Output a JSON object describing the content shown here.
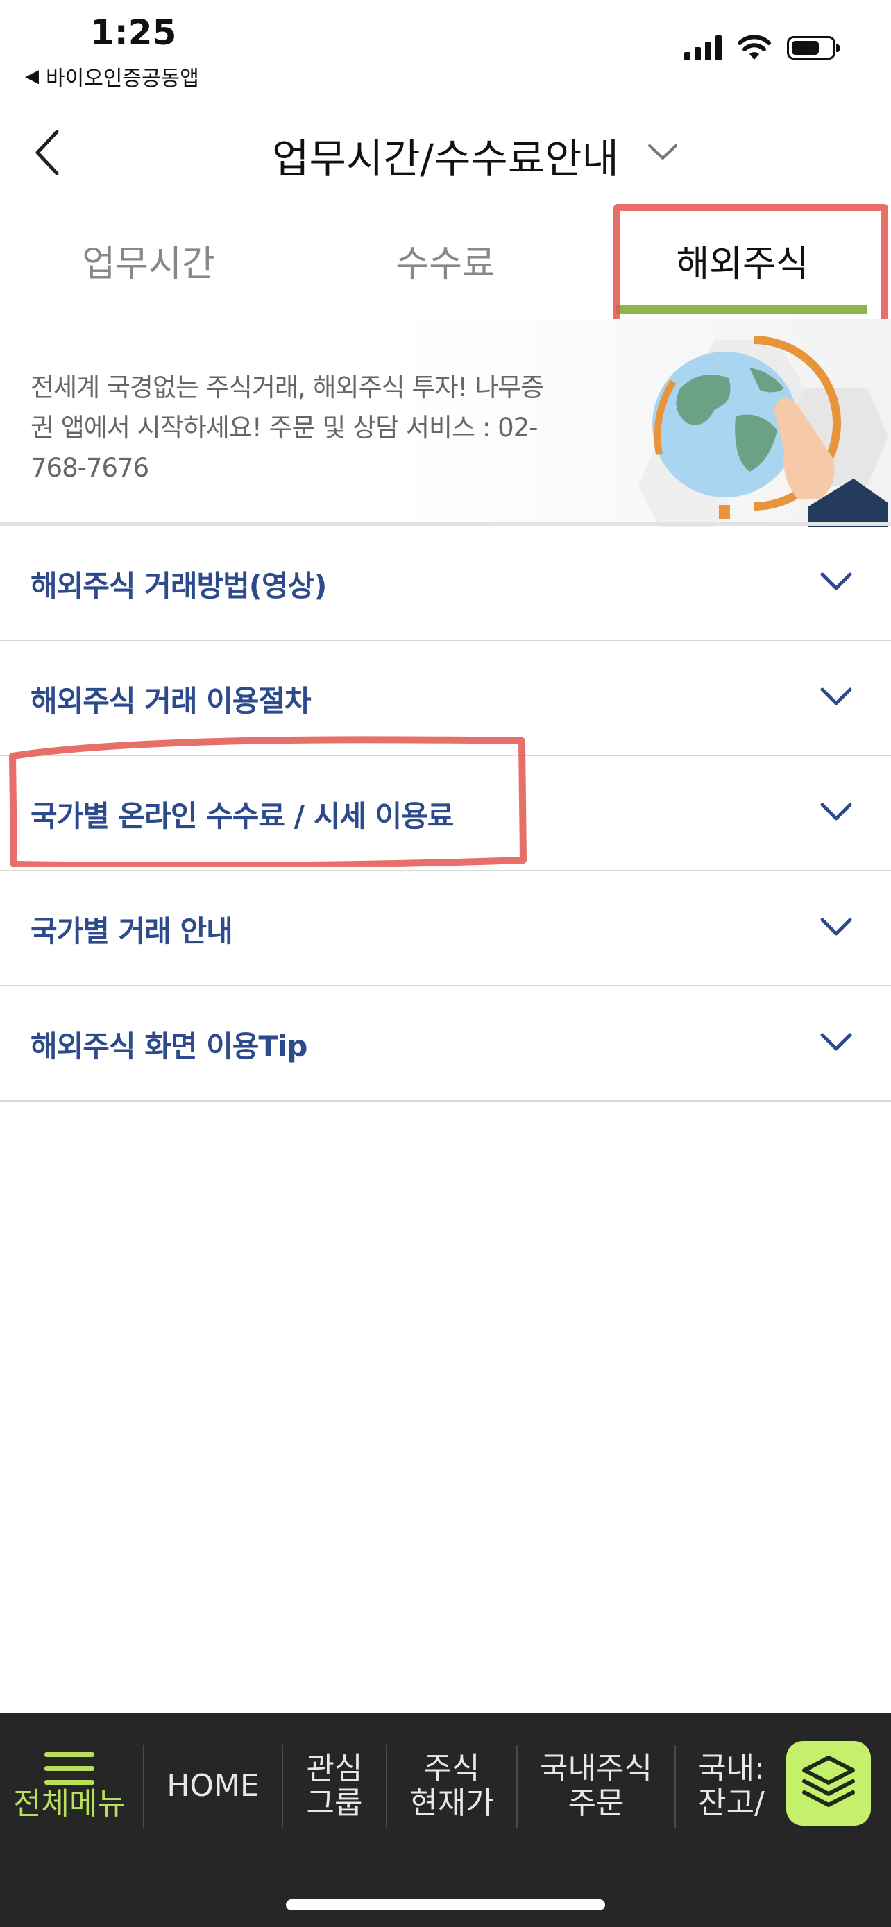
{
  "status_bar": {
    "time": "1:25",
    "back_app_label": "바이오인증공동앱",
    "back_app_icon": "back-triangle-icon",
    "icons": [
      "signal-icon",
      "wifi-icon",
      "battery-icon"
    ],
    "battery_level": 0.7
  },
  "header": {
    "title": "업무시간/수수료안내",
    "back_icon": "chevron-left-icon",
    "dropdown_icon": "chevron-down-icon"
  },
  "tabs": [
    {
      "label": "업무시간",
      "active": false
    },
    {
      "label": "수수료",
      "active": false
    },
    {
      "label": "해외주식",
      "active": true
    }
  ],
  "banner": {
    "text_lines": [
      "전세계 국경없는 주식거래, 해외주식 투자! 나무증",
      "권 앱에서 시작하세요! 주문 및 상담 서비스 : 02-",
      "768-7676"
    ],
    "image_icon": "globe-icon"
  },
  "accordion": [
    {
      "label": "해외주식 거래방법(영상)"
    },
    {
      "label": "해외주식 거래 이용절차"
    },
    {
      "label": "국가별 온라인 수수료 / 시세 이용료"
    },
    {
      "label": "국가별 거래 안내"
    },
    {
      "label": "해외주식 화면 이용Tip"
    }
  ],
  "bottom_nav": {
    "menu": {
      "label": "전체메뉴",
      "icon": "hamburger-icon"
    },
    "items": [
      {
        "line1": "HOME",
        "line2": ""
      },
      {
        "line1": "관심",
        "line2": "그룹"
      },
      {
        "line1": "주식",
        "line2": "현재가"
      },
      {
        "line1": "국내주식",
        "line2": "주문"
      },
      {
        "line1": "국내:",
        "line2": "잔고/"
      }
    ],
    "layer_icon": "layers-icon"
  },
  "colors": {
    "accent_green": "#8db54c",
    "link_blue": "#2d4a8c",
    "annotation_red": "#e2574c",
    "nav_bg": "#262626",
    "nav_highlight": "#b9e05b"
  }
}
